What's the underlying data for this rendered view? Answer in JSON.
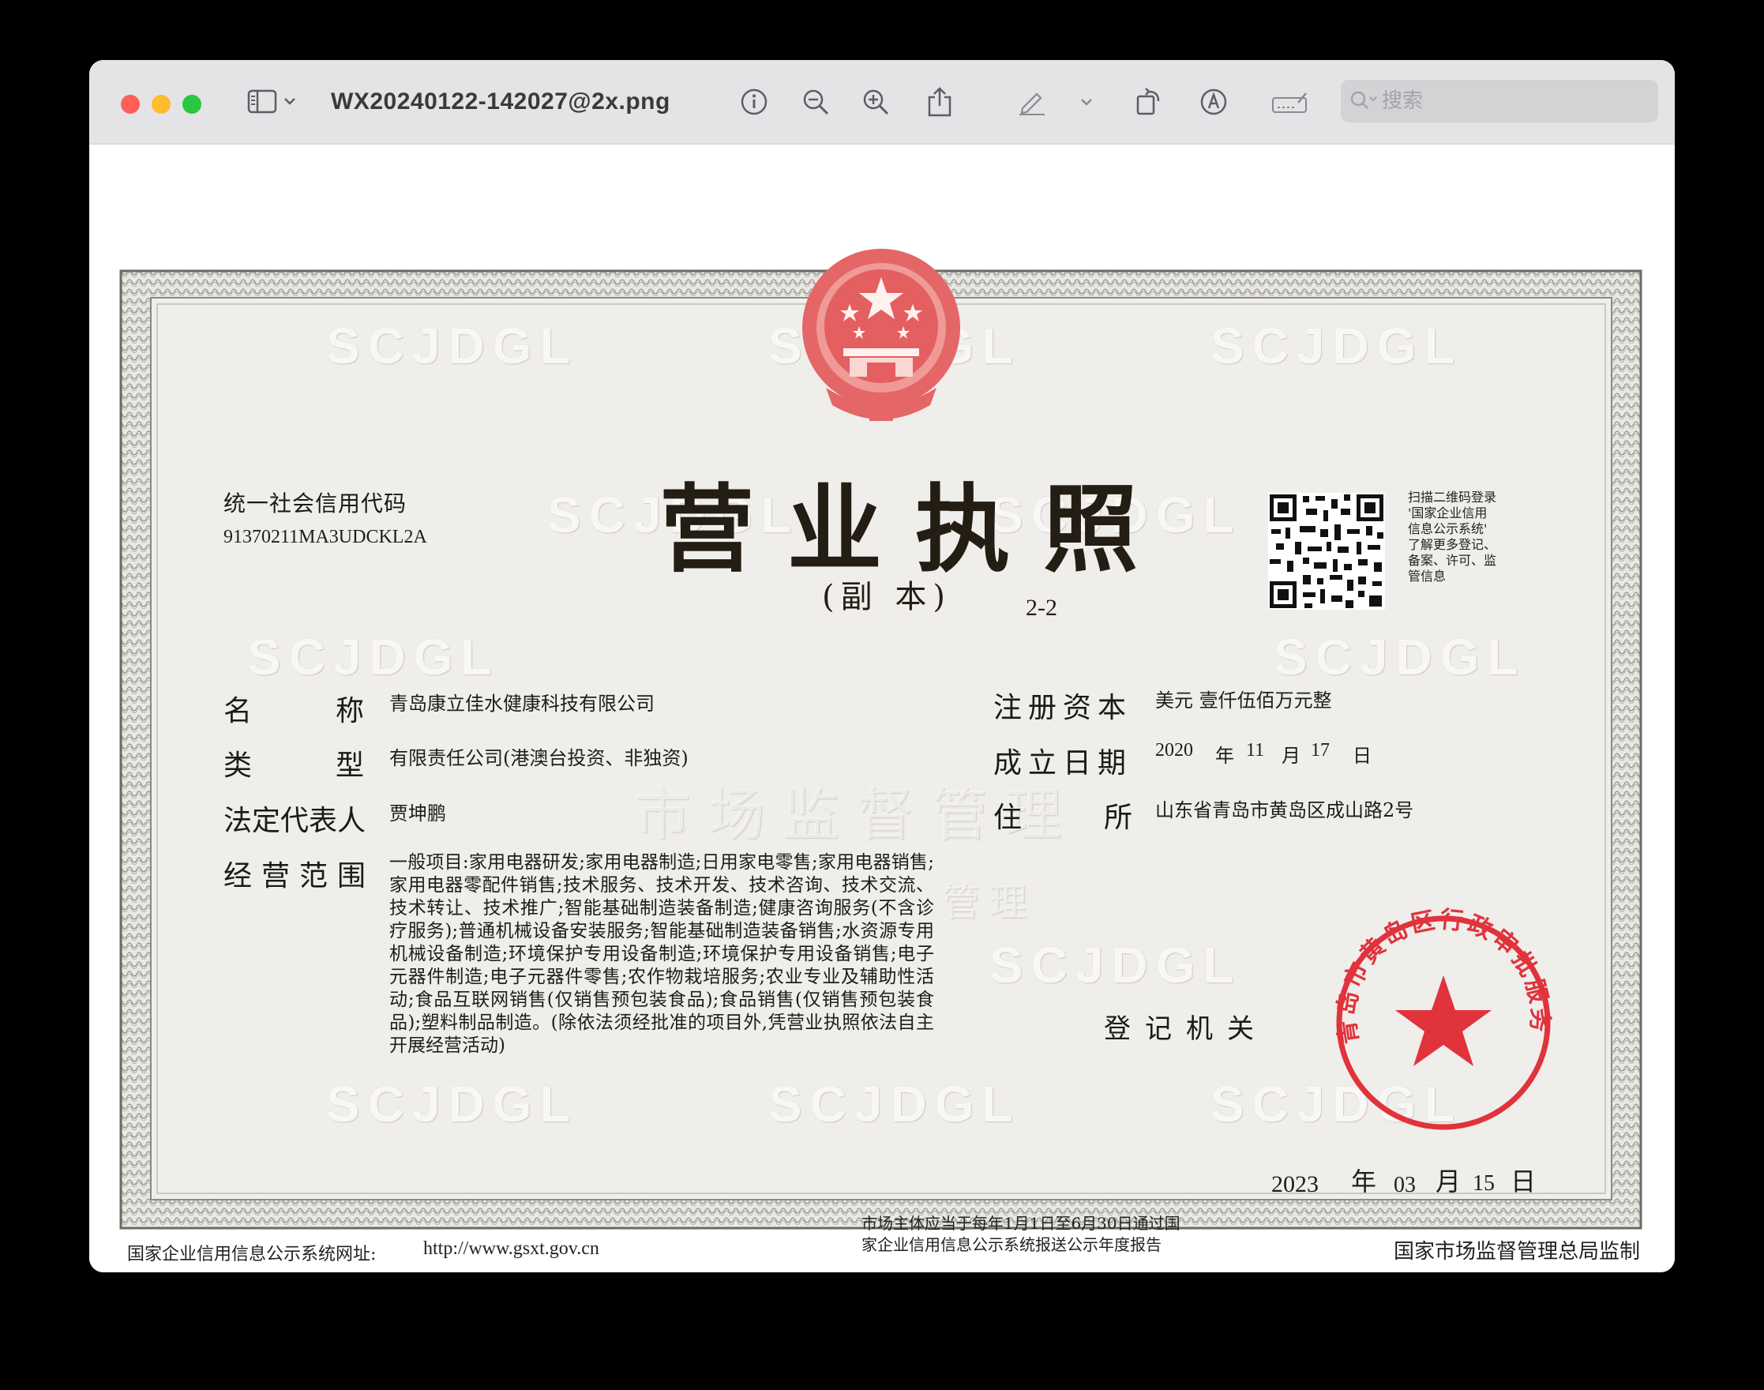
{
  "window": {
    "title": "WX20240122-142027@2x.png",
    "search_placeholder": "搜索",
    "toolbar_icons": [
      "sidebar-icon",
      "chevron-down-icon",
      "info-icon",
      "zoom-out-icon",
      "zoom-in-icon",
      "share-icon",
      "markup-pen-icon",
      "chevron-down-icon",
      "rotate-icon",
      "annotate-icon",
      "form-fill-icon",
      "search-icon"
    ]
  },
  "license": {
    "credit_code_label": "统一社会信用代码",
    "credit_code": "91370211MA3UDCKL2A",
    "title": "营业执照",
    "subtitle": "(副 本)",
    "copy_number": "2-2",
    "qr_note": [
      "扫描二维码登录",
      "'国家企业信用",
      "信息公示系统'",
      "了解更多登记、",
      "备案、许可、监",
      "管信息"
    ],
    "name_label_1": "名",
    "name_label_2": "称",
    "name": "青岛康立佳水健康科技有限公司",
    "type_label_1": "类",
    "type_label_2": "型",
    "type": "有限责任公司(港澳台投资、非独资)",
    "legal_rep_label": "法定代表人",
    "legal_rep": "贾坤鹏",
    "scope_label": "经营范围",
    "scope": "一般项目:家用电器研发;家用电器制造;日用家电零售;家用电器销售;家用电器零配件销售;技术服务、技术开发、技术咨询、技术交流、技术转让、技术推广;智能基础制造装备制造;健康咨询服务(不含诊疗服务);普通机械设备安装服务;智能基础制造装备销售;水资源专用机械设备制造;环境保护专用设备制造;环境保护专用设备销售;电子元器件制造;电子元器件零售;农作物栽培服务;农业专业及辅助性活动;食品互联网销售(仅销售预包装食品);食品销售(仅销售预包装食品);塑料制品制造。(除依法须经批准的项目外,凭营业执照依法自主开展经营活动)",
    "capital_label": "注册资本",
    "capital": "美元 壹仟伍佰万元整",
    "founded_label": "成立日期",
    "founded_year": "2020",
    "founded_month": "11",
    "founded_day": "17",
    "unit_year": "年",
    "unit_month": "月",
    "unit_day": "日",
    "address_label_1": "住",
    "address_label_2": "所",
    "address": "山东省青岛市黄岛区成山路2号",
    "authority_label": "登记机关",
    "issue_year": "2023",
    "issue_month": "03",
    "issue_day": "15",
    "seal_text": "青岛市黄岛区行政审批服务局",
    "watermark": "SCJDGL",
    "watermark_big": "市场监督管理",
    "watermark_small": "管理",
    "footer_site_label": "国家企业信用信息公示系统网址:",
    "footer_site_url": "http://www.gsxt.gov.cn",
    "footer_notice_1": "市场主体应当于每年1月1日至6月30日通过国",
    "footer_notice_2": "家企业信用信息公示系统报送公示年度报告",
    "footer_supervisor": "国家市场监督管理总局监制"
  }
}
